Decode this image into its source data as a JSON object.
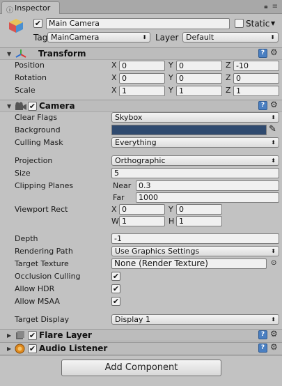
{
  "tab": {
    "title": "Inspector"
  },
  "object": {
    "active_checked": true,
    "name": "Main Camera",
    "static_label": "Static",
    "tag_label": "Tag",
    "tag_value": "MainCamera",
    "layer_label": "Layer",
    "layer_value": "Default"
  },
  "transform": {
    "title": "Transform",
    "rows": [
      {
        "label": "Position",
        "x": "0",
        "y": "0",
        "z": "-10"
      },
      {
        "label": "Rotation",
        "x": "0",
        "y": "0",
        "z": "0"
      },
      {
        "label": "Scale",
        "x": "1",
        "y": "1",
        "z": "1"
      }
    ],
    "axis_x": "X",
    "axis_y": "Y",
    "axis_z": "Z"
  },
  "camera": {
    "title": "Camera",
    "enabled": true,
    "clear_flags_label": "Clear Flags",
    "clear_flags_value": "Skybox",
    "background_label": "Background",
    "background_color": "#2f4a6f",
    "culling_mask_label": "Culling Mask",
    "culling_mask_value": "Everything",
    "projection_label": "Projection",
    "projection_value": "Orthographic",
    "size_label": "Size",
    "size_value": "5",
    "clipping_label": "Clipping Planes",
    "near_label": "Near",
    "near_value": "0.3",
    "far_label": "Far",
    "far_value": "1000",
    "viewport_label": "Viewport Rect",
    "vp_x_label": "X",
    "vp_x": "0",
    "vp_y_label": "Y",
    "vp_y": "0",
    "vp_w_label": "W",
    "vp_w": "1",
    "vp_h_label": "H",
    "vp_h": "1",
    "depth_label": "Depth",
    "depth_value": "-1",
    "rendering_path_label": "Rendering Path",
    "rendering_path_value": "Use Graphics Settings",
    "target_texture_label": "Target Texture",
    "target_texture_value": "None (Render Texture)",
    "occlusion_label": "Occlusion Culling",
    "occlusion_checked": true,
    "hdr_label": "Allow HDR",
    "hdr_checked": true,
    "msaa_label": "Allow MSAA",
    "msaa_checked": true,
    "target_display_label": "Target Display",
    "target_display_value": "Display 1"
  },
  "flare_layer": {
    "title": "Flare Layer",
    "enabled": true
  },
  "audio_listener": {
    "title": "Audio Listener",
    "enabled": true
  },
  "add_component_label": "Add Component",
  "check_glyph": "✔",
  "arrow_glyph": "▼",
  "fold_glyph": "▼",
  "help_glyph": "?",
  "gear_glyph": "⚙"
}
